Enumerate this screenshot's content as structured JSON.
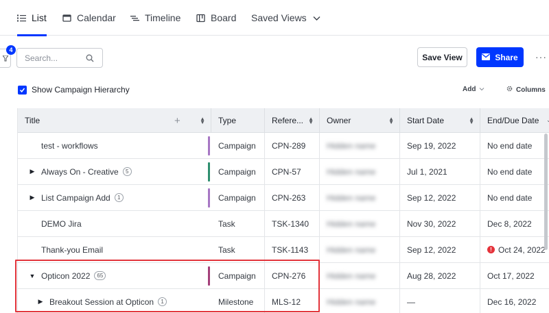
{
  "tabs": [
    {
      "label": "List",
      "icon": "list-icon",
      "active": true
    },
    {
      "label": "Calendar",
      "icon": "calendar-icon"
    },
    {
      "label": "Timeline",
      "icon": "timeline-icon"
    },
    {
      "label": "Board",
      "icon": "board-icon"
    },
    {
      "label": "Saved Views",
      "icon": "chevron-down-icon"
    }
  ],
  "toolbar": {
    "filter_count": "4",
    "search_placeholder": "Search...",
    "save_view_label": "Save View",
    "share_label": "Share",
    "more_label": "···"
  },
  "options": {
    "hierarchy_label": "Show Campaign Hierarchy",
    "hierarchy_checked": true,
    "add_label": "Add",
    "columns_label": "Columns"
  },
  "table": {
    "columns": [
      "Title",
      "Type",
      "Refere...",
      "Owner",
      "Start Date",
      "End/Due Date"
    ],
    "rows": [
      {
        "title": "test - workflows",
        "expand": "",
        "count": "",
        "type": "Campaign",
        "stripe": "#a777c4",
        "ref": "CPN-289",
        "owner": "Hidden name",
        "start": "Sep 19, 2022",
        "end": "No end date",
        "warn": false
      },
      {
        "title": "Always On - Creative",
        "expand": "▶",
        "count": "5",
        "type": "Campaign",
        "stripe": "#2f8f6f",
        "ref": "CPN-57",
        "owner": "Hidden name",
        "start": "Jul 1, 2021",
        "end": "No end date",
        "warn": false
      },
      {
        "title": "List Campaign Add",
        "expand": "▶",
        "count": "1",
        "type": "Campaign",
        "stripe": "#a777c4",
        "ref": "CPN-263",
        "owner": "Hidden name",
        "start": "Sep 12, 2022",
        "end": "No end date",
        "warn": false
      },
      {
        "title": "DEMO Jira",
        "expand": "",
        "count": "",
        "type": "Task",
        "stripe": "",
        "ref": "TSK-1340",
        "owner": "Hidden name",
        "start": "Nov 30, 2022",
        "end": "Dec 8, 2022",
        "warn": false
      },
      {
        "title": "Thank-you Email",
        "expand": "",
        "count": "",
        "type": "Task",
        "stripe": "",
        "ref": "TSK-1143",
        "owner": "Hidden name",
        "start": "Sep 12, 2022",
        "end": "Oct 24, 2022",
        "warn": true
      },
      {
        "title": "Opticon 2022",
        "expand": "▼",
        "count": "65",
        "type": "Campaign",
        "stripe": "#a4407a",
        "ref": "CPN-276",
        "owner": "Hidden name",
        "start": "Aug 28, 2022",
        "end": "Oct 17, 2022",
        "warn": false
      },
      {
        "title": "Breakout Session at Opticon",
        "expand": "▶",
        "count": "1",
        "type": "Milestone",
        "stripe": "",
        "ref": "MLS-12",
        "owner": "Hidden name",
        "start": "—",
        "end": "Dec 16, 2022",
        "warn": false,
        "indent": true
      }
    ]
  },
  "colors": {
    "accent": "#0037ff",
    "highlight": "#e2333a",
    "warning": "#e5333b"
  }
}
